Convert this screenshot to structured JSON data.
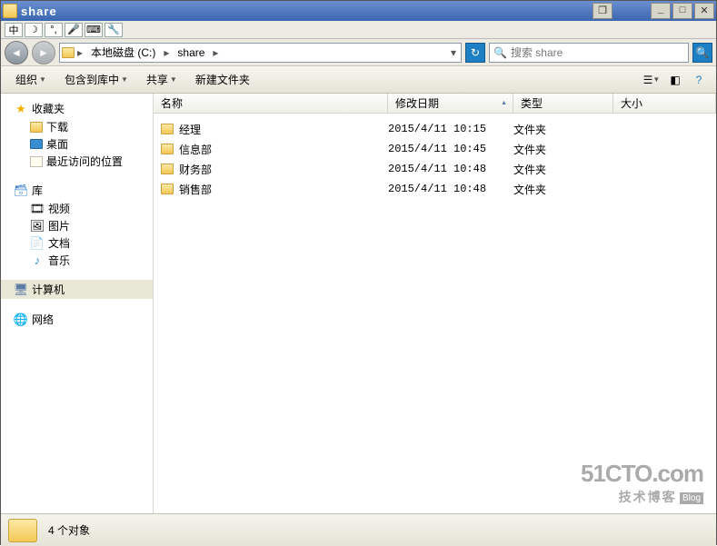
{
  "window": {
    "title": "share",
    "ime_buttons": [
      "中",
      "☽",
      "°,",
      "🎤",
      "⌨",
      "🔧"
    ]
  },
  "address": {
    "crumbs": [
      "本地磁盘 (C:)",
      "share"
    ],
    "search_placeholder": "搜索 share"
  },
  "toolbar": {
    "organize": "组织",
    "include": "包含到库中",
    "share": "共享",
    "new_folder": "新建文件夹"
  },
  "sidebar": {
    "favorites": {
      "label": "收藏夹",
      "items": [
        "下载",
        "桌面",
        "最近访问的位置"
      ]
    },
    "libraries": {
      "label": "库",
      "items": [
        "视频",
        "图片",
        "文档",
        "音乐"
      ]
    },
    "computer": {
      "label": "计算机"
    },
    "network": {
      "label": "网络"
    }
  },
  "columns": {
    "name": "名称",
    "date": "修改日期",
    "type": "类型",
    "size": "大小"
  },
  "rows": [
    {
      "name": "经理",
      "date": "2015/4/11 10:15",
      "type": "文件夹"
    },
    {
      "name": "信息部",
      "date": "2015/4/11 10:45",
      "type": "文件夹"
    },
    {
      "name": "财务部",
      "date": "2015/4/11 10:48",
      "type": "文件夹"
    },
    {
      "name": "销售部",
      "date": "2015/4/11 10:48",
      "type": "文件夹"
    }
  ],
  "status": {
    "text": "4 个对象"
  },
  "watermark": {
    "line1": "51CTO.com",
    "line2": "技术博客",
    "blog": "Blog"
  }
}
